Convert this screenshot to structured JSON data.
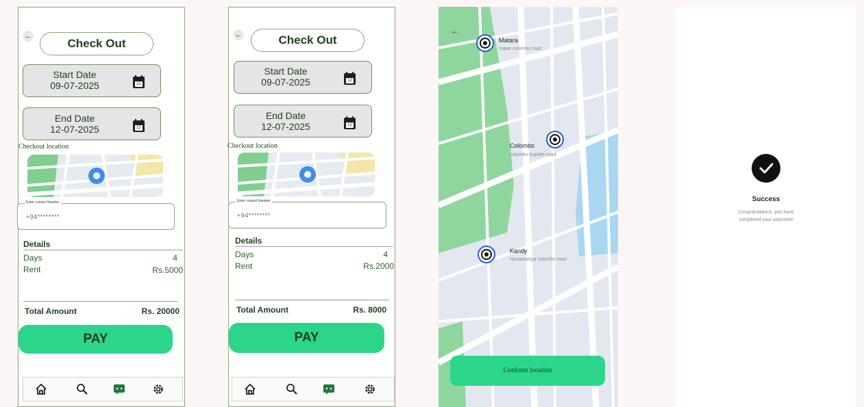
{
  "screens": [
    {
      "title": "Check Out",
      "start_date": {
        "label": "Start Date",
        "value": "09-07-2025",
        "icon_text": "12"
      },
      "end_date": {
        "label": "End Date",
        "value": "12-07-2025",
        "icon_text": "12"
      },
      "checkout_location_label": "Checkout location",
      "contact": {
        "label": "Enter contact Number",
        "value": "+94********"
      },
      "details_title": "Details",
      "days_label": "Days",
      "days_value": "4",
      "rent_label": "Rent",
      "rent_value": "Rs.5000",
      "total_label": "Total Amount",
      "total_value": "Rs. 20000",
      "pay_label": "PAY"
    },
    {
      "title": "Check Out",
      "start_date": {
        "label": "Start Date",
        "value": "09-07-2025",
        "icon_text": "12"
      },
      "end_date": {
        "label": "End Date",
        "value": "12-07-2025",
        "icon_text": "12"
      },
      "checkout_location_label": "Checkout location",
      "contact": {
        "label": "Enter contact Number",
        "value": "+94********"
      },
      "details_title": "Details",
      "days_label": "Days",
      "days_value": "4",
      "rent_label": "Rent",
      "rent_value": "Rs.2000",
      "total_label": "Total Amount",
      "total_value": "Rs. 8000",
      "pay_label": "PAY"
    }
  ],
  "nav_icons": [
    "home-icon",
    "search-icon",
    "chat-icon",
    "settings-icon"
  ],
  "map_screen": {
    "locations": [
      {
        "name": "Matara",
        "address": "matar colombo road"
      },
      {
        "name": "Colombo",
        "address": "colombo malabe road"
      },
      {
        "name": "Kandy",
        "address": "Nuwaraeliya colombo road"
      }
    ],
    "confirm_label": "Conform location"
  },
  "success_screen": {
    "title": "Success",
    "message_line1": "Congratulations, you have",
    "message_line2": "completed your payment!"
  },
  "colors": {
    "accent": "#2bd68b",
    "dark_green": "#1f3d1f",
    "pin_blue": "#2a5bd7"
  }
}
